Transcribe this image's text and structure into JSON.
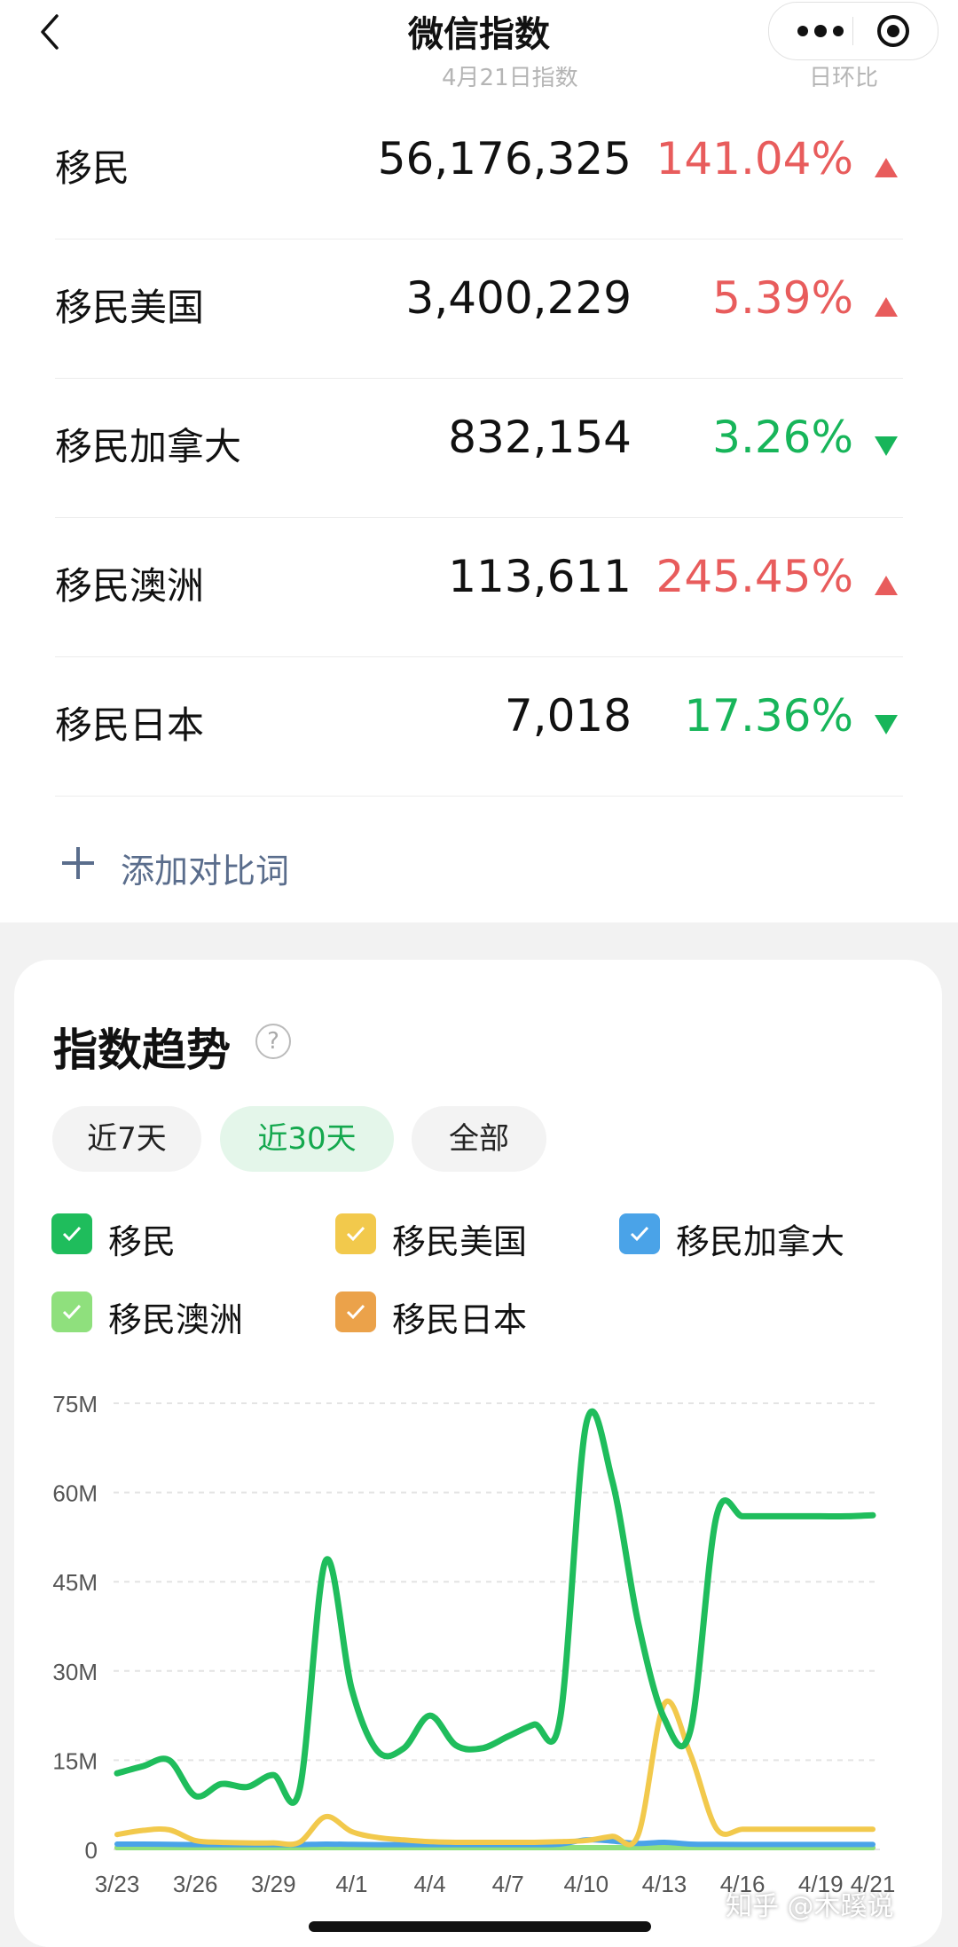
{
  "header": {
    "title": "微信指数"
  },
  "table": {
    "col_index": "4月21日指数",
    "col_change": "日环比",
    "rows": [
      {
        "name": "移民",
        "value": "56,176,325",
        "change": "141.04%",
        "trend": "up"
      },
      {
        "name": "移民美国",
        "value": "3,400,229",
        "change": "5.39%",
        "trend": "up"
      },
      {
        "name": "移民加拿大",
        "value": "832,154",
        "change": "3.26%",
        "trend": "down"
      },
      {
        "name": "移民澳洲",
        "value": "113,611",
        "change": "245.45%",
        "trend": "up"
      },
      {
        "name": "移民日本",
        "value": "7,018",
        "change": "17.36%",
        "trend": "down"
      }
    ],
    "add_label": "添加对比词"
  },
  "trend": {
    "title": "指数趋势",
    "help_icon": "?",
    "tabs": [
      {
        "label": "近7天",
        "active": false
      },
      {
        "label": "近30天",
        "active": true
      },
      {
        "label": "全部",
        "active": false
      }
    ]
  },
  "colors": {
    "up": "#e85c5c",
    "down": "#17b55a",
    "tab_active": "#14a84e"
  },
  "chart_data": {
    "type": "line",
    "x": [
      "3/23",
      "3/24",
      "3/25",
      "3/26",
      "3/27",
      "3/28",
      "3/29",
      "3/30",
      "3/31",
      "4/1",
      "4/2",
      "4/3",
      "4/4",
      "4/5",
      "4/6",
      "4/7",
      "4/8",
      "4/9",
      "4/10",
      "4/11",
      "4/12",
      "4/13",
      "4/14",
      "4/15",
      "4/16",
      "4/17",
      "4/18",
      "4/19",
      "4/20",
      "4/21"
    ],
    "xticks": [
      "3/23",
      "3/26",
      "3/29",
      "4/1",
      "4/4",
      "4/7",
      "4/10",
      "4/13",
      "4/16",
      "4/19",
      "4/21"
    ],
    "yticks": [
      "0",
      "15M",
      "30M",
      "45M",
      "60M",
      "75M"
    ],
    "ylim": [
      0,
      75000000
    ],
    "series": [
      {
        "name": "移民",
        "color": "#1fbd5c",
        "values": [
          12800000,
          14000000,
          15000000,
          9000000,
          11000000,
          10500000,
          12500000,
          10000000,
          48500000,
          27000000,
          16500000,
          17000000,
          22500000,
          17500000,
          17000000,
          19000000,
          21000000,
          22000000,
          71500000,
          62000000,
          38000000,
          22000000,
          20000000,
          56000000,
          56000000,
          56000000,
          56000000,
          56000000,
          56000000,
          56176325
        ]
      },
      {
        "name": "移民美国",
        "color": "#f2c94c",
        "values": [
          2500000,
          3200000,
          3300000,
          1500000,
          1200000,
          1100000,
          1100000,
          1200000,
          5500000,
          3000000,
          2000000,
          1600000,
          1300000,
          1200000,
          1200000,
          1200000,
          1200000,
          1300000,
          1500000,
          2200000,
          2500000,
          24500000,
          16000000,
          3500000,
          3400000,
          3400229,
          3400229,
          3400229,
          3400229,
          3400229
        ]
      },
      {
        "name": "移民加拿大",
        "color": "#4aa3e8",
        "values": [
          900000,
          900000,
          850000,
          800000,
          800000,
          800000,
          800000,
          800000,
          900000,
          850000,
          800000,
          800000,
          800000,
          800000,
          800000,
          800000,
          800000,
          900000,
          1600000,
          1400000,
          1000000,
          1200000,
          900000,
          850000,
          832154,
          832154,
          832154,
          832154,
          832154,
          832154
        ]
      },
      {
        "name": "移民澳洲",
        "color": "#8fe07d",
        "values": [
          100000,
          100000,
          100000,
          100000,
          100000,
          100000,
          100000,
          100000,
          120000,
          110000,
          100000,
          100000,
          100000,
          100000,
          100000,
          100000,
          100000,
          100000,
          120000,
          110000,
          100000,
          100000,
          33000,
          113611,
          113611,
          113611,
          113611,
          113611,
          113611,
          113611
        ]
      },
      {
        "name": "移民日本",
        "color": "#eba24a",
        "values": [
          7000,
          7000,
          7000,
          7000,
          7000,
          7000,
          7000,
          7000,
          7000,
          7000,
          7000,
          7000,
          7000,
          7000,
          7000,
          7000,
          7000,
          7000,
          7000,
          7000,
          7000,
          7000,
          6000,
          7018,
          7018,
          7018,
          7018,
          7018,
          7018,
          7018
        ]
      }
    ]
  }
}
